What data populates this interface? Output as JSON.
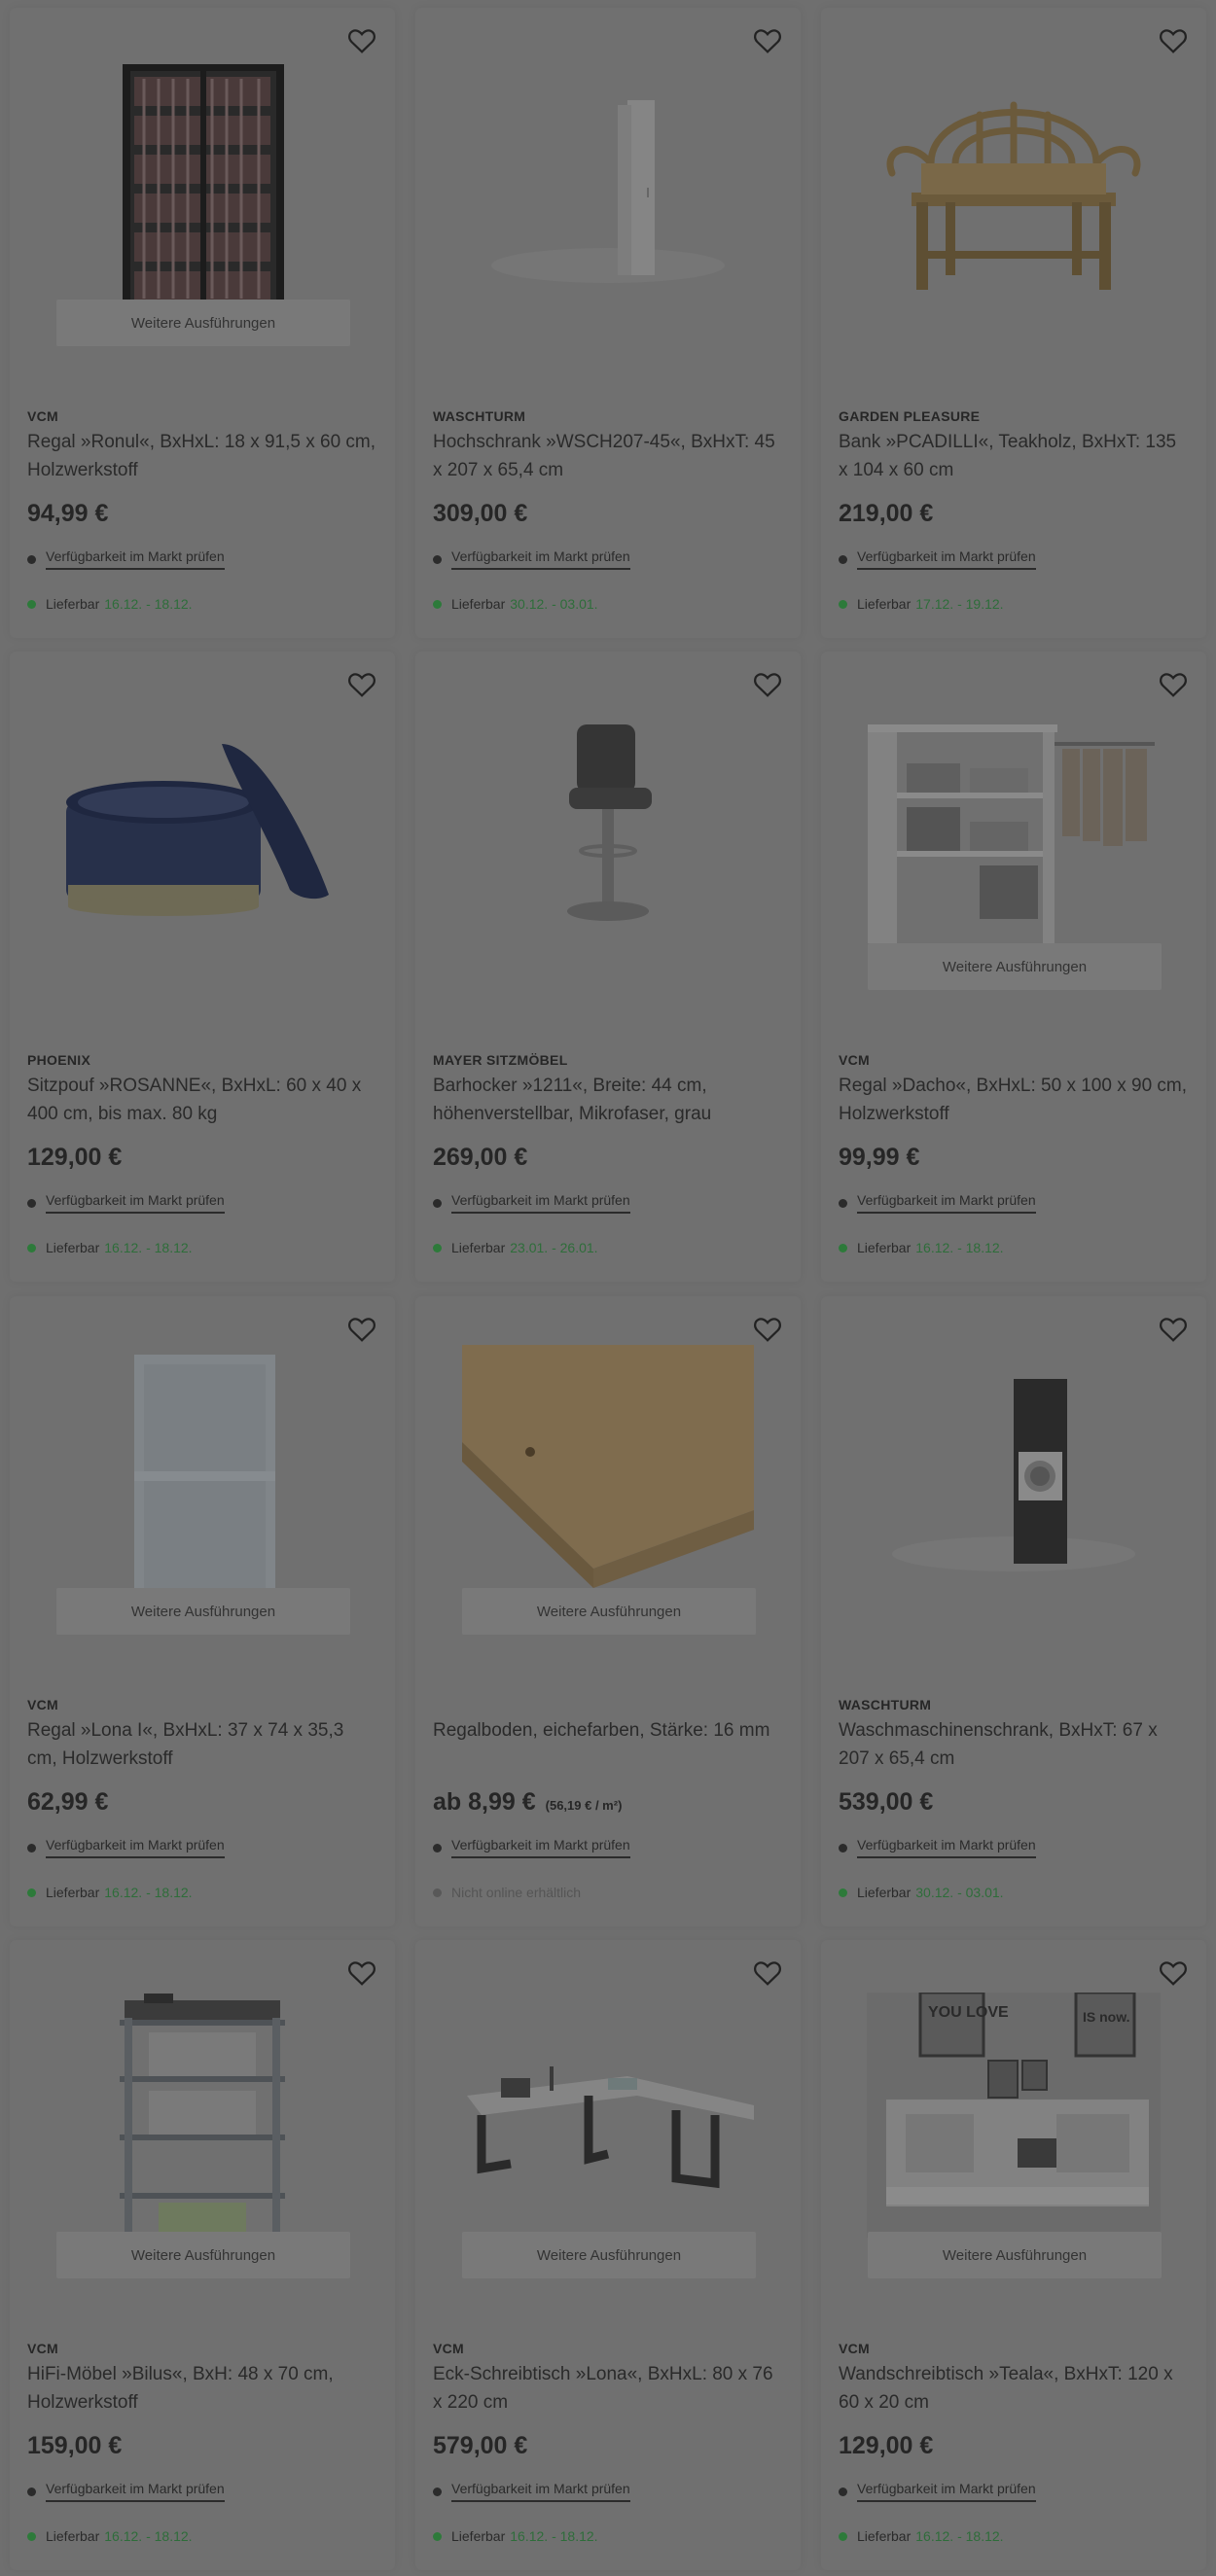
{
  "variant_label": "Weitere Ausführungen",
  "availability_label": "Verfügbarkeit im Markt prüfen",
  "delivery_label": "Lieferbar",
  "products": [
    {
      "brand": "VCM",
      "title": "Regal »Ronul«, BxHxL: 18 x 91,5 x 60 cm, Holzwerkstoff",
      "price": "94,99 €",
      "delivery": "16.12. - 18.12.",
      "has_variants": true,
      "image": "cd-shelf"
    },
    {
      "brand": "WASCHTURM",
      "title": "Hochschrank »WSCH207-45«, BxHxT: 45 x 207 x 65,4 cm",
      "price": "309,00 €",
      "delivery": "30.12. - 03.01.",
      "has_variants": false,
      "image": "tall-cabinet"
    },
    {
      "brand": "GARDEN PLEASURE",
      "title": "Bank »PCADILLI«, Teakholz, BxHxT: 135 x 104 x 60 cm",
      "price": "219,00 €",
      "delivery": "17.12. - 19.12.",
      "has_variants": false,
      "image": "garden-bench"
    },
    {
      "brand": "PHOENIX",
      "title": "Sitzpouf »ROSANNE«, BxHxL: 60 x 40 x 400 cm, bis max. 80 kg",
      "price": "129,00 €",
      "delivery": "16.12. - 18.12.",
      "has_variants": false,
      "image": "pouf"
    },
    {
      "brand": "MAYER SITZMÖBEL",
      "title": "Barhocker »1211«, Breite: 44 cm, höhenverstellbar, Mikrofaser, grau",
      "price": "269,00 €",
      "delivery": "23.01. - 26.01.",
      "has_variants": false,
      "image": "bar-stool"
    },
    {
      "brand": "VCM",
      "title": "Regal »Dacho«, BxHxL: 50 x 100 x 90 cm, Holzwerkstoff",
      "price": "99,99 €",
      "delivery": "16.12. - 18.12.",
      "has_variants": true,
      "image": "wardrobe-shelf"
    },
    {
      "brand": "VCM",
      "title": "Regal »Lona I«, BxHxL: 37 x 74 x 35,3 cm, Holzwerkstoff",
      "price": "62,99 €",
      "delivery": "16.12. - 18.12.",
      "has_variants": true,
      "image": "small-shelf"
    },
    {
      "brand": "",
      "title": "Regalboden, eichefarben, Stärke: 16 mm",
      "price": "ab 8,99 €",
      "unit_price": "(56,19 € / m²)",
      "delivery": "",
      "delivery_text": "Nicht online erhältlich",
      "has_variants": true,
      "image": "shelf-board"
    },
    {
      "brand": "WASCHTURM",
      "title": "Waschmaschinenschrank, BxHxT: 67 x 207 x 65,4 cm",
      "price": "539,00 €",
      "delivery": "30.12. - 03.01.",
      "has_variants": false,
      "image": "washer-cabinet"
    },
    {
      "brand": "VCM",
      "title": "HiFi-Möbel »Bilus«, BxH: 48 x 70 cm, Holzwerkstoff",
      "price": "159,00 €",
      "delivery": "16.12. - 18.12.",
      "has_variants": true,
      "image": "hifi-rack"
    },
    {
      "brand": "VCM",
      "title": "Eck-Schreibtisch »Lona«, BxHxL: 80 x 76 x 220 cm",
      "price": "579,00 €",
      "delivery": "16.12. - 18.12.",
      "has_variants": true,
      "image": "corner-desk"
    },
    {
      "brand": "VCM",
      "title": "Wandschreibtisch »Teala«, BxHxT: 120 x 60 x 20 cm",
      "price": "129,00 €",
      "delivery": "16.12. - 18.12.",
      "has_variants": true,
      "image": "wall-desk",
      "poster_left": "YOU LOVE",
      "poster_right": "IS now."
    }
  ]
}
